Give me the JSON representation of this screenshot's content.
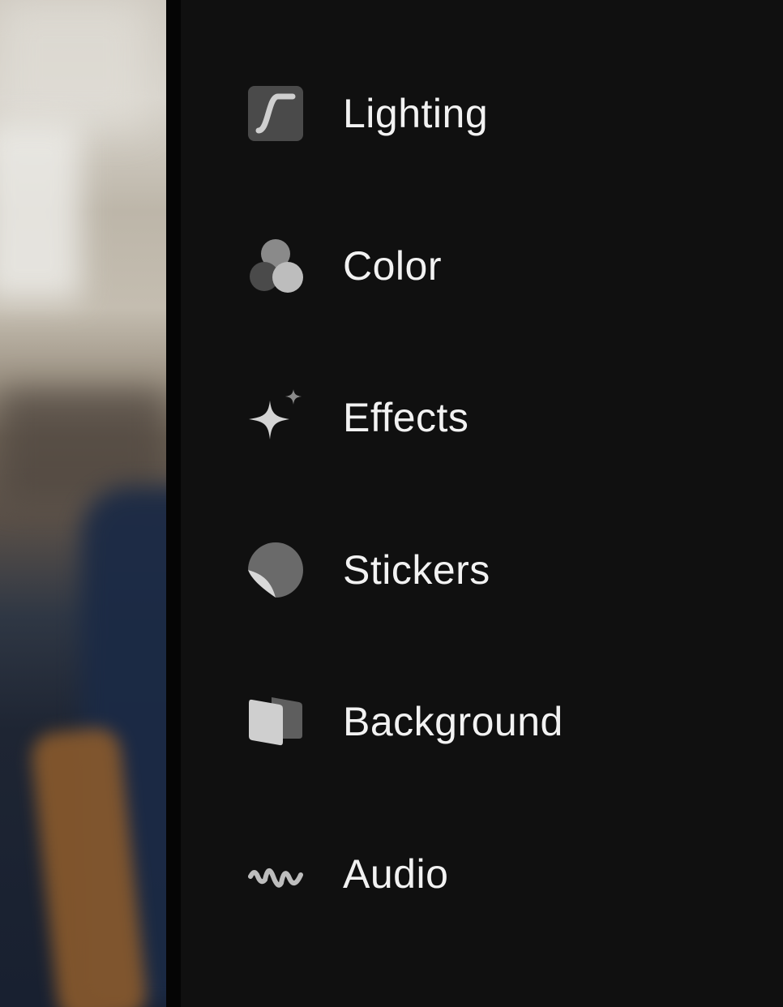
{
  "menu": {
    "items": [
      {
        "id": "lighting",
        "label": "Lighting",
        "icon": "lighting-curve-icon"
      },
      {
        "id": "color",
        "label": "Color",
        "icon": "color-circles-icon"
      },
      {
        "id": "effects",
        "label": "Effects",
        "icon": "sparkle-icon"
      },
      {
        "id": "stickers",
        "label": "Stickers",
        "icon": "sticker-peel-icon"
      },
      {
        "id": "background",
        "label": "Background",
        "icon": "background-layers-icon"
      },
      {
        "id": "audio",
        "label": "Audio",
        "icon": "audio-wave-icon"
      }
    ]
  },
  "colors": {
    "panel_bg": "#101010",
    "label": "#f2f2f2",
    "icon_light": "#cfcfcf",
    "icon_mid": "#8a8a8a",
    "icon_dark": "#4a4a4a"
  }
}
